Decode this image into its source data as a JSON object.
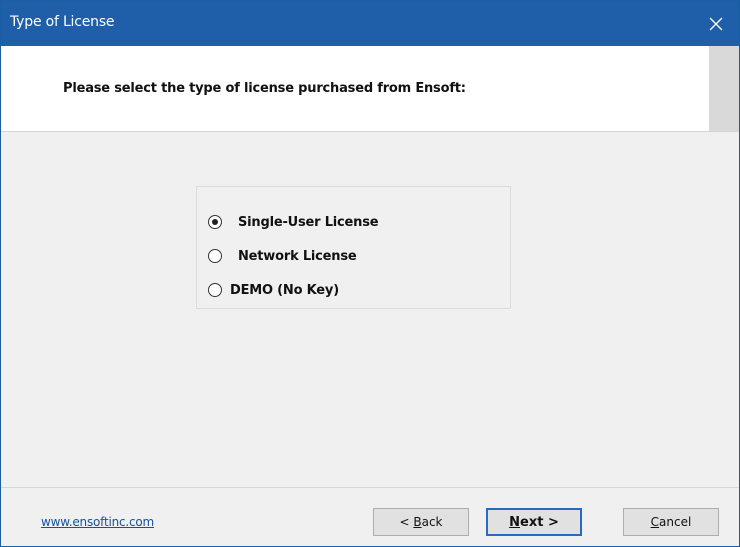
{
  "window": {
    "title": "Type of License",
    "close_glyph": "✕"
  },
  "header": {
    "prompt": "Please select the type of license purchased from Ensoft:"
  },
  "options": [
    {
      "label": "Single-User License",
      "selected": true
    },
    {
      "label": "Network License",
      "selected": false
    },
    {
      "label": "DEMO (No Key)",
      "selected": false
    }
  ],
  "footer": {
    "link": "www.ensoftinc.com",
    "back_prefix": "< ",
    "back_mnemonic": "B",
    "back_rest": "ack",
    "next_mnemonic": "N",
    "next_rest": "ext >",
    "cancel_mnemonic": "C",
    "cancel_rest": "ancel"
  },
  "colors": {
    "titlebar": "#1f5fa9",
    "default_button_border": "#2869c4",
    "link": "#1a4f9c"
  },
  "icons": {
    "close": "close-icon"
  }
}
